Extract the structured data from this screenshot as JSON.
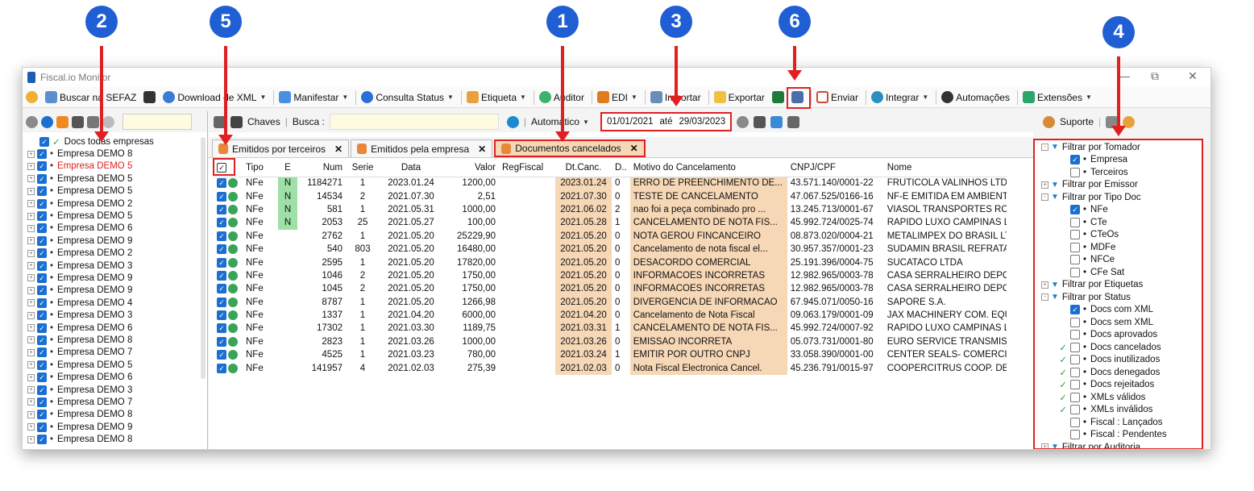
{
  "window": {
    "title": "Fiscal.io Monitor"
  },
  "toolbar": {
    "buscar": "Buscar na SEFAZ",
    "download": "Download de XML",
    "manifestar": "Manifestar",
    "consulta": "Consulta Status",
    "etiqueta": "Etiqueta",
    "auditor": "Auditor",
    "edi": "EDI",
    "importar": "Importar",
    "exportar": "Exportar",
    "enviar": "Enviar",
    "integrar": "Integrar",
    "automacoes": "Automações",
    "extensoes": "Extensões"
  },
  "search": {
    "chaves": "Chaves",
    "busca": "Busca :",
    "auto": "Automático",
    "date_from": "01/01/2021",
    "ate": "até",
    "date_to": "29/03/2023"
  },
  "tabs": [
    {
      "label": "Emitidos por terceiros"
    },
    {
      "label": "Emitidos pela empresa"
    },
    {
      "label": "Documentos cancelados"
    }
  ],
  "columns": [
    "Tipo",
    "E",
    "Num",
    "Serie",
    "Data",
    "Valor",
    "RegFiscal",
    "Dt.Canc.",
    "D..",
    "Motivo do Cancelamento",
    "CNPJ/CPF",
    "Nome"
  ],
  "rows": [
    [
      "NFe",
      "N",
      "1184271",
      "1",
      "2023.01.24",
      "1200,00",
      "",
      "2023.01.24",
      "0",
      "ERRO DE PREENCHIMENTO DE...",
      "43.571.140/0001-22",
      "FRUTICOLA VALINHOS LTD"
    ],
    [
      "NFe",
      "N",
      "14534",
      "2",
      "2021.07.30",
      "2,51",
      "",
      "2021.07.30",
      "0",
      "TESTE DE CANCELAMENTO",
      "47.067.525/0166-16",
      "NF-E EMITIDA EM AMBIENT"
    ],
    [
      "NFe",
      "N",
      "581",
      "1",
      "2021.05.31",
      "1000,00",
      "",
      "2021.06.02",
      "2",
      "nao foi a peça combinado pro ...",
      "13.245.713/0001-67",
      "VIASOL TRANSPORTES RO"
    ],
    [
      "NFe",
      "N",
      "2053",
      "25",
      "2021.05.27",
      "100,00",
      "",
      "2021.05.28",
      "1",
      "CANCELAMENTO DE NOTA FIS...",
      "45.992.724/0025-74",
      "RAPIDO LUXO CAMPINAS L"
    ],
    [
      "NFe",
      "",
      "2762",
      "1",
      "2021.05.20",
      "25229,90",
      "",
      "2021.05.20",
      "0",
      "NOTA GEROU FINCANCEIRO",
      "08.873.020/0004-21",
      "METALIMPEX DO BRASIL LT"
    ],
    [
      "NFe",
      "",
      "540",
      "803",
      "2021.05.20",
      "16480,00",
      "",
      "2021.05.20",
      "0",
      "Cancelamento de nota fiscal el...",
      "30.957.357/0001-23",
      "SUDAMIN BRASIL REFRATA"
    ],
    [
      "NFe",
      "",
      "2595",
      "1",
      "2021.05.20",
      "17820,00",
      "",
      "2021.05.20",
      "0",
      "DESACORDO COMERCIAL",
      "25.191.396/0004-75",
      "SUCATACO LTDA"
    ],
    [
      "NFe",
      "",
      "1046",
      "2",
      "2021.05.20",
      "1750,00",
      "",
      "2021.05.20",
      "0",
      "INFORMACOES INCORRETAS",
      "12.982.965/0003-78",
      "CASA SERRALHEIRO DEPO"
    ],
    [
      "NFe",
      "",
      "1045",
      "2",
      "2021.05.20",
      "1750,00",
      "",
      "2021.05.20",
      "0",
      "INFORMACOES INCORRETAS",
      "12.982.965/0003-78",
      "CASA SERRALHEIRO DEPO"
    ],
    [
      "NFe",
      "",
      "8787",
      "1",
      "2021.05.20",
      "1266,98",
      "",
      "2021.05.20",
      "0",
      "DIVERGENCIA DE INFORMACAO",
      "67.945.071/0050-16",
      "SAPORE S.A."
    ],
    [
      "NFe",
      "",
      "1337",
      "1",
      "2021.04.20",
      "6000,00",
      "",
      "2021.04.20",
      "0",
      "Cancelamento de Nota Fiscal",
      "09.063.179/0001-09",
      "JAX MACHINERY COM. EQU"
    ],
    [
      "NFe",
      "",
      "17302",
      "1",
      "2021.03.30",
      "1189,75",
      "",
      "2021.03.31",
      "1",
      "CANCELAMENTO DE NOTA FIS...",
      "45.992.724/0007-92",
      "RAPIDO LUXO CAMPINAS L"
    ],
    [
      "NFe",
      "",
      "2823",
      "1",
      "2021.03.26",
      "1000,00",
      "",
      "2021.03.26",
      "0",
      "EMISSAO INCORRETA",
      "05.073.731/0001-80",
      "EURO SERVICE TRANSMIS"
    ],
    [
      "NFe",
      "",
      "4525",
      "1",
      "2021.03.23",
      "780,00",
      "",
      "2021.03.24",
      "1",
      "EMITIR POR OUTRO CNPJ",
      "33.058.390/0001-00",
      "CENTER SEALS- COMERCI"
    ],
    [
      "NFe",
      "",
      "141957",
      "4",
      "2021.02.03",
      "275,39",
      "",
      "2021.02.03",
      "0",
      "Nota Fiscal Electronica Cancel.",
      "45.236.791/0015-97",
      "COOPERCITRUS COOP. DE"
    ]
  ],
  "left_tree": [
    {
      "label": "Docs todas empresas",
      "color": "#111111",
      "root": true
    },
    {
      "label": "Empresa DEMO 8",
      "color": "#111111"
    },
    {
      "label": "Empresa DEMO 5",
      "color": "#e02020"
    },
    {
      "label": "Empresa DEMO 5",
      "color": "#111111"
    },
    {
      "label": "Empresa DEMO 5",
      "color": "#111111"
    },
    {
      "label": "Empresa DEMO 2",
      "color": "#111111"
    },
    {
      "label": "Empresa DEMO 5",
      "color": "#111111"
    },
    {
      "label": "Empresa DEMO 6",
      "color": "#111111"
    },
    {
      "label": "Empresa DEMO 9",
      "color": "#111111"
    },
    {
      "label": "Empresa DEMO 2",
      "color": "#111111"
    },
    {
      "label": "Empresa DEMO 3",
      "color": "#111111"
    },
    {
      "label": "Empresa DEMO 9",
      "color": "#111111"
    },
    {
      "label": "Empresa DEMO 9",
      "color": "#111111"
    },
    {
      "label": "Empresa DEMO 4",
      "color": "#111111"
    },
    {
      "label": "Empresa DEMO 3",
      "color": "#111111"
    },
    {
      "label": "Empresa DEMO 6",
      "color": "#111111"
    },
    {
      "label": "Empresa DEMO 8",
      "color": "#111111"
    },
    {
      "label": "Empresa DEMO 7",
      "color": "#111111"
    },
    {
      "label": "Empresa DEMO 5",
      "color": "#111111"
    },
    {
      "label": "Empresa DEMO 6",
      "color": "#111111"
    },
    {
      "label": "Empresa DEMO 3",
      "color": "#111111"
    },
    {
      "label": "Empresa DEMO 7",
      "color": "#111111"
    },
    {
      "label": "Empresa DEMO 8",
      "color": "#111111"
    },
    {
      "label": "Empresa DEMO 9",
      "color": "#111111"
    },
    {
      "label": "Empresa DEMO 8",
      "color": "#111111"
    }
  ],
  "right_panel": {
    "suporte": "Suporte",
    "filters": [
      {
        "label": "Filtrar por Tomador",
        "level": 0,
        "expander": "-"
      },
      {
        "label": "Empresa",
        "level": 1,
        "state": "checked"
      },
      {
        "label": "Terceiros",
        "level": 1,
        "state": "unchecked"
      },
      {
        "label": "Filtrar por Emissor",
        "level": 0,
        "expander": "+"
      },
      {
        "label": "Filtrar por Tipo Doc",
        "level": 0,
        "expander": "-"
      },
      {
        "label": "NFe",
        "level": 1,
        "state": "checked"
      },
      {
        "label": "CTe",
        "level": 1,
        "state": "unchecked"
      },
      {
        "label": "CTeOs",
        "level": 1,
        "state": "unchecked"
      },
      {
        "label": "MDFe",
        "level": 1,
        "state": "unchecked"
      },
      {
        "label": "NFCe",
        "level": 1,
        "state": "unchecked"
      },
      {
        "label": "CFe Sat",
        "level": 1,
        "state": "unchecked"
      },
      {
        "label": "Filtrar por Etiquetas",
        "level": 0,
        "expander": "+"
      },
      {
        "label": "Filtrar por Status",
        "level": 0,
        "expander": "-"
      },
      {
        "label": "Docs com XML",
        "level": 1,
        "state": "checked"
      },
      {
        "label": "Docs sem XML",
        "level": 1,
        "state": "unchecked"
      },
      {
        "label": "Docs aprovados",
        "level": 1,
        "state": "unchecked"
      },
      {
        "label": "Docs cancelados",
        "level": 1,
        "state": "unchecked",
        "tick": true
      },
      {
        "label": "Docs inutilizados",
        "level": 1,
        "state": "unchecked",
        "tick": true
      },
      {
        "label": "Docs denegados",
        "level": 1,
        "state": "unchecked",
        "tick": true
      },
      {
        "label": "Docs rejeitados",
        "level": 1,
        "state": "unchecked",
        "tick": true
      },
      {
        "label": "XMLs válidos",
        "level": 1,
        "state": "unchecked",
        "tick": true
      },
      {
        "label": "XMLs inválidos",
        "level": 1,
        "state": "unchecked",
        "tick": true
      },
      {
        "label": "Fiscal : Lançados",
        "level": 1,
        "state": "unchecked"
      },
      {
        "label": "Fiscal : Pendentes",
        "level": 1,
        "state": "unchecked"
      },
      {
        "label": "Filtrar por Auditoria",
        "level": 0,
        "expander": "+"
      }
    ]
  },
  "annotations": [
    "1",
    "2",
    "3",
    "4",
    "5",
    "6"
  ],
  "colors": {
    "accent": "#1f5fd3",
    "highlight": "#e02020",
    "peach": "#f6d7b6",
    "checkbox": "#1b6fd1"
  }
}
